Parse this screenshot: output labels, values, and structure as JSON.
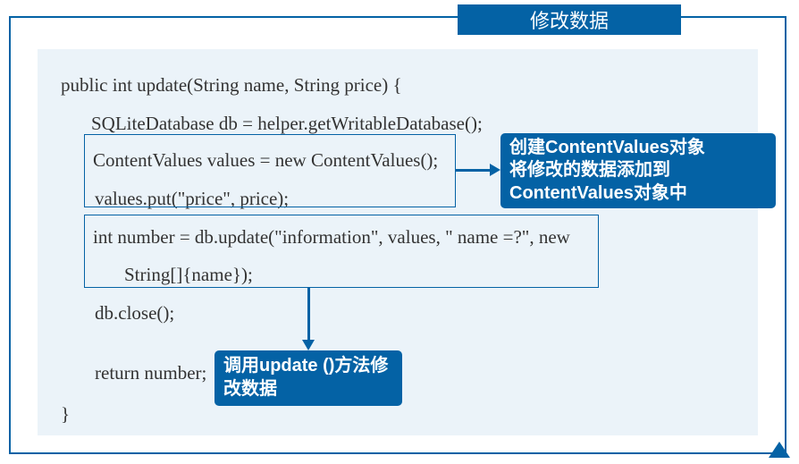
{
  "title": "修改数据",
  "code": {
    "line1": "public int update(String name, String price) {",
    "line2": "SQLiteDatabase db = helper.getWritableDatabase();",
    "line3": "ContentValues values = new ContentValues();",
    "line4": "values.put(\"price\", price);",
    "line5": "int number = db.update(\"information\", values, \" name =?\", new",
    "line6": "String[]{name});",
    "line7": "db.close();",
    "line8": "return number;",
    "line9": "}"
  },
  "callout1": {
    "line1": "创建ContentValues对象",
    "line2": "将修改的数据添加到",
    "line3": "ContentValues对象中"
  },
  "callout2": {
    "line1": "调用update ()方法修",
    "line2": "改数据"
  }
}
